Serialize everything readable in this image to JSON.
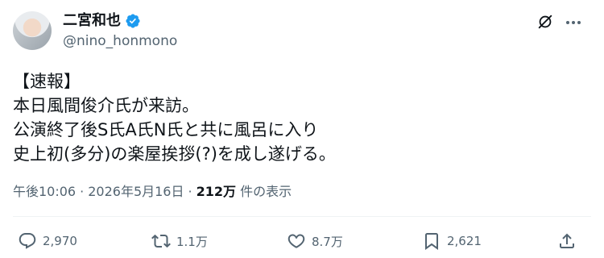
{
  "user": {
    "display_name": "二宮和也",
    "handle": "@nino_honmono",
    "verified_color": "#1d9bf0"
  },
  "tweet": {
    "lines": [
      "【速報】",
      "本日風間俊介氏が来訪。",
      "公演終了後S氏A氏N氏と共に風呂に入り",
      "史上初(多分)の楽屋挨拶(?)を成し遂げる。"
    ]
  },
  "meta": {
    "time": "午後10:06",
    "separator": "·",
    "date": "2026年5月16日",
    "views_count": "212万",
    "views_label": "件の表示"
  },
  "actions": {
    "reply_count": "2,970",
    "retweet_count": "1.1万",
    "like_count": "8.7万",
    "bookmark_count": "2,621"
  },
  "icons": {
    "verified": "verified-badge-icon",
    "grok": "grok-icon",
    "more": "more-icon",
    "reply": "reply-icon",
    "retweet": "retweet-icon",
    "like": "heart-icon",
    "bookmark": "bookmark-icon",
    "share": "share-icon"
  }
}
